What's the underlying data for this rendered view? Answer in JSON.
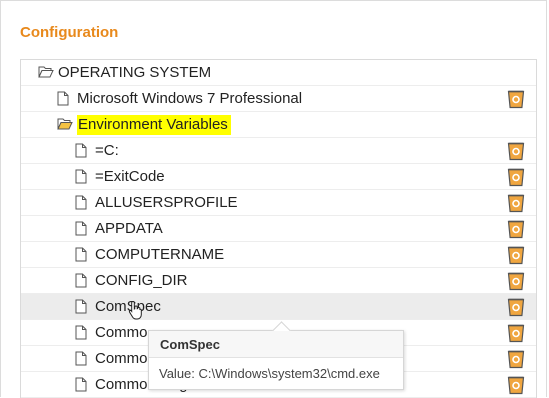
{
  "section": {
    "title": "Configuration"
  },
  "tree": {
    "root": {
      "label": "OPERATING SYSTEM",
      "icon": "folder-open-icon"
    },
    "os_name": {
      "label": "Microsoft Windows 7 Professional",
      "icon": "file-icon"
    },
    "env": {
      "label": "Environment Variables",
      "icon": "folder-open-icon",
      "highlight_color": "#ffff00"
    },
    "variables": [
      {
        "label": "=C:"
      },
      {
        "label": "=ExitCode"
      },
      {
        "label": "ALLUSERSPROFILE"
      },
      {
        "label": "APPDATA"
      },
      {
        "label": "COMPUTERNAME"
      },
      {
        "label": "CONFIG_DIR"
      },
      {
        "label": "ComSpec"
      },
      {
        "label": "Commo"
      },
      {
        "label": "Commo"
      },
      {
        "label": "CommonProgramW6432"
      }
    ]
  },
  "tooltip": {
    "title": "ComSpec",
    "body": "Value: C:\\Windows\\system32\\cmd.exe"
  },
  "colors": {
    "accent": "#e8891c",
    "trash_body": "#f0a640",
    "trash_outline": "#555555",
    "hover_row": "#ececec"
  }
}
